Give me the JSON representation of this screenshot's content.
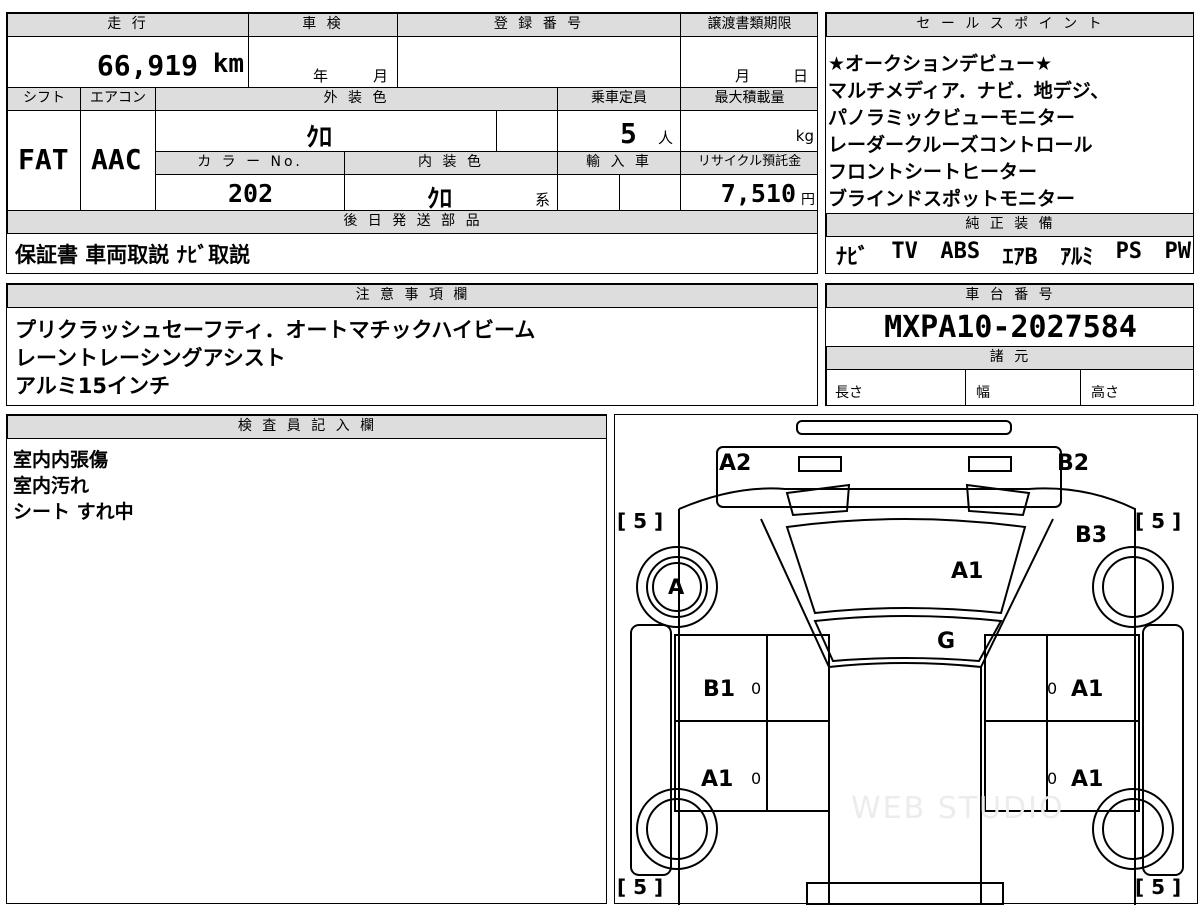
{
  "vehicle": {
    "mileage_label": "走 行",
    "mileage_value": "66,919",
    "mileage_unit": "km",
    "inspection_label": "車 検",
    "inspection_year": "年",
    "inspection_month": "月",
    "registration_label": "登 録 番 号",
    "transfer_label": "譲渡書類期限",
    "transfer_month": "月",
    "transfer_day": "日",
    "shift_label": "シフト",
    "shift_value": "FAT",
    "ac_label": "エアコン",
    "ac_value": "AAC",
    "exterior_label": "外 装 色",
    "exterior_value": "ｸﾛ",
    "capacity_label": "乗車定員",
    "capacity_value": "5",
    "capacity_unit": "人",
    "load_label": "最大積載量",
    "load_unit": "kg",
    "color_no_label": "カ ラ ー No.",
    "color_no_value": "202",
    "interior_label": "内 装 色",
    "interior_value": "ｸﾛ",
    "interior_suffix": "系",
    "import_label": "輸 入 車",
    "recycle_label": "リサイクル預託金",
    "recycle_value": "7,510",
    "recycle_unit": "円"
  },
  "sales": {
    "header": "セ ー ル ス ポ イ ン ト",
    "lines": [
      "★オークションデビュー★",
      "マルチメディア．ナビ．地デジ、",
      "パノラミックビューモニター",
      "レーダークルーズコントロール",
      "フロントシートヒーター",
      "ブラインドスポットモニター"
    ]
  },
  "shipping": {
    "header": "後 日 発 送 部 品",
    "value": "保証書 車両取説 ﾅﾋﾞ取説"
  },
  "equipment": {
    "header": "純 正 装 備",
    "items": [
      "ﾅﾋﾞ",
      "TV",
      "ABS",
      "ｴｱB",
      "ｱﾙﾐ",
      "PS",
      "PW"
    ]
  },
  "notes": {
    "header": "注 意 事 項 欄",
    "lines": [
      "プリクラッシュセーフティ．オートマチックハイビーム",
      "レーントレーシングアシスト",
      "アルミ15インチ"
    ]
  },
  "chassis": {
    "header": "車 台 番 号",
    "value": "MXPA10-2027584",
    "specs_header": "諸 元",
    "length_label": "長さ",
    "width_label": "幅",
    "height_label": "高さ"
  },
  "inspector": {
    "header": "検 査 員 記 入 欄",
    "lines": [
      "室内内張傷",
      "室内汚れ",
      "シート すれ中"
    ]
  },
  "diagram": {
    "labels": {
      "a2": "A2",
      "b2": "B2",
      "b3": "B3",
      "a1_hood": "A1",
      "g": "G",
      "b1_left": "B1",
      "a1_right_front": "A1",
      "a1_left_rear": "A1",
      "a1_right_rear": "A1",
      "a_wheel": "A"
    },
    "tire_marks": [
      "[ 5 ]",
      "[ 5 ]",
      "[ 5 ]",
      "[ 5 ]"
    ],
    "zero_mark": "0",
    "watermark": "WEB STUDIO"
  }
}
